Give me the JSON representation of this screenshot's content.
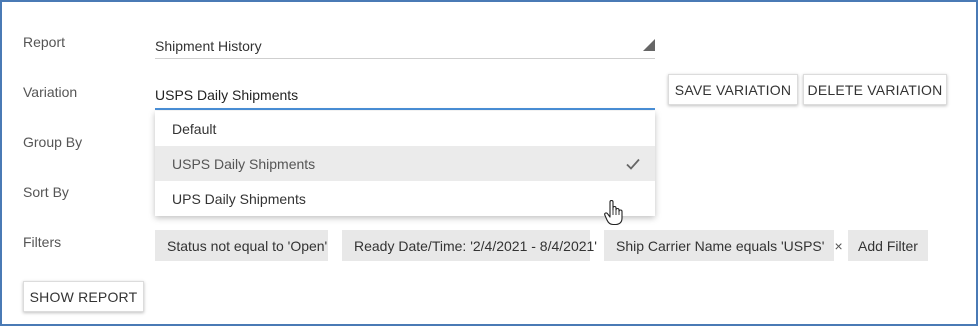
{
  "form": {
    "report_label": "Report",
    "report_value": "Shipment History",
    "variation_label": "Variation",
    "variation_value": "USPS Daily Shipments",
    "group_by_label": "Group By",
    "sort_by_label": "Sort By",
    "filters_label": "Filters"
  },
  "buttons": {
    "save_variation": "SAVE VARIATION",
    "delete_variation": "DELETE VARIATION",
    "show_report": "SHOW REPORT",
    "add_filter": "Add Filter"
  },
  "dropdown": {
    "options": [
      {
        "label": "Default",
        "selected": false
      },
      {
        "label": "USPS Daily Shipments",
        "selected": true
      },
      {
        "label": "UPS Daily Shipments",
        "selected": false
      }
    ]
  },
  "filters": [
    {
      "label": "Status not equal to 'Open'",
      "removable": false
    },
    {
      "label": "Ready Date/Time: '2/4/2021 - 8/4/2021'",
      "removable": false
    },
    {
      "label": "Ship Carrier Name equals 'USPS'",
      "removable": true,
      "close": "×"
    }
  ],
  "icons": {
    "report_arrow": "dropdown-arrow-icon",
    "check": "checkmark-icon",
    "cursor": "hand-pointer-icon"
  },
  "colors": {
    "frame": "#4a7ab5",
    "focus_underline": "#4a90d9",
    "chip_bg": "#e8e8e8",
    "selected_bg": "#ebebeb"
  }
}
